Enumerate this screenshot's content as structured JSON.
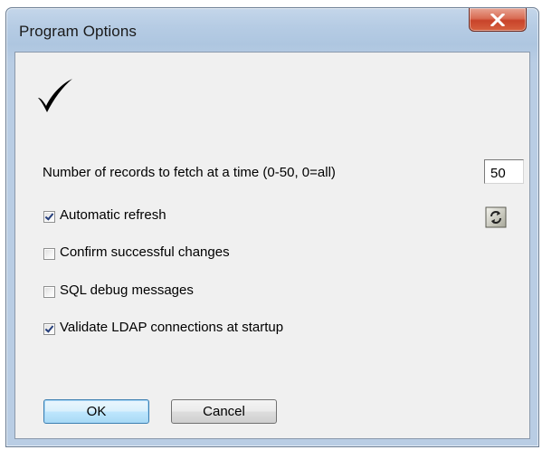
{
  "window": {
    "title": "Program Options"
  },
  "options": {
    "records_label": "Number of records to fetch at a time (0-50, 0=all)",
    "records_value": "50",
    "checkboxes": [
      {
        "label": "Automatic refresh",
        "checked": true
      },
      {
        "label": "Confirm successful changes",
        "checked": false
      },
      {
        "label": "SQL debug messages",
        "checked": false
      },
      {
        "label": "Validate LDAP connections at startup",
        "checked": true
      }
    ]
  },
  "buttons": {
    "ok_label": "OK",
    "cancel_label": "Cancel"
  },
  "icons": {
    "title_close": "close-icon",
    "header": "checkmark-icon",
    "refresh": "refresh-icon"
  },
  "colors": {
    "close_button": "#c8432a",
    "checkbox_mark": "#243d7a",
    "default_button_border": "#3c7fb1",
    "dialog_background": "#f0f0f0"
  }
}
